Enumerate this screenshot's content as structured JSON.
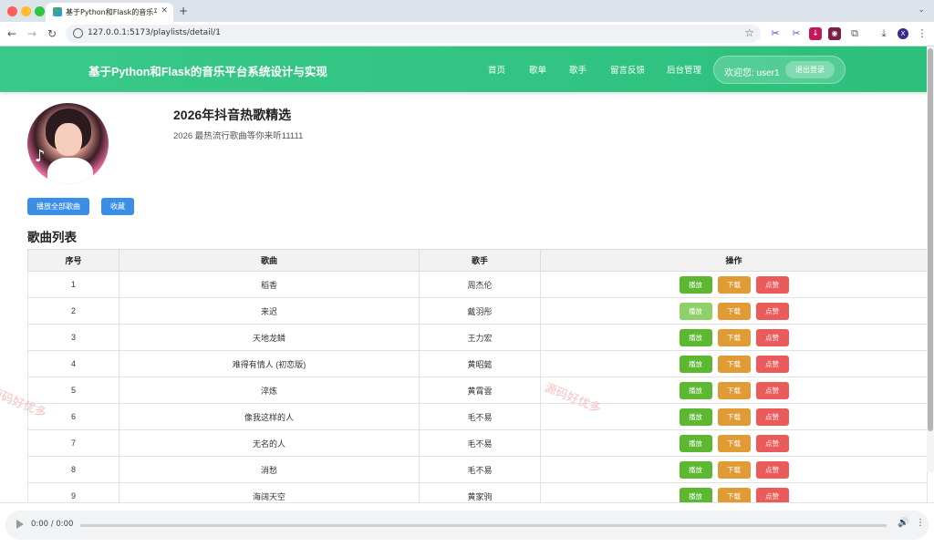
{
  "browser": {
    "tab_title": "基于Python和Flask的音乐平台",
    "url": "127.0.0.1:5173/playlists/detail/1",
    "profile_initial": "X"
  },
  "header": {
    "site_title": "基于Python和Flask的音乐平台系统设计与实现",
    "nav": [
      {
        "label": "首页"
      },
      {
        "label": "歌单"
      },
      {
        "label": "歌手"
      },
      {
        "label": "留言反馈"
      },
      {
        "label": "后台管理"
      }
    ],
    "welcome": "欢迎您: user1",
    "logout_label": "退出登录"
  },
  "playlist": {
    "title": "2026年抖音热歌精选",
    "description": "2026 最热流行歌曲等你来听11111",
    "play_all_label": "播放全部歌曲",
    "favorite_label": "收藏"
  },
  "songs_section": {
    "title": "歌曲列表",
    "columns": [
      "序号",
      "歌曲",
      "歌手",
      "操作"
    ],
    "action_labels": {
      "play": "播放",
      "download": "下载",
      "like": "点赞"
    },
    "rows": [
      {
        "no": "1",
        "song": "稻香",
        "artist": "周杰伦"
      },
      {
        "no": "2",
        "song": "来迟",
        "artist": "戴羽彤"
      },
      {
        "no": "3",
        "song": "天地龙鳞",
        "artist": "王力宏"
      },
      {
        "no": "4",
        "song": "难得有情人 (初恋版)",
        "artist": "黄昭懿"
      },
      {
        "no": "5",
        "song": "淬炼",
        "artist": "黄霄雲"
      },
      {
        "no": "6",
        "song": "像我这样的人",
        "artist": "毛不易"
      },
      {
        "no": "7",
        "song": "无名的人",
        "artist": "毛不易"
      },
      {
        "no": "8",
        "song": "消愁",
        "artist": "毛不易"
      },
      {
        "no": "9",
        "song": "海阔天空",
        "artist": "黄家驹"
      }
    ]
  },
  "player": {
    "time": "0:00 / 0:00"
  },
  "watermark": "源码好优多",
  "colors": {
    "header_green": "#2cc07c",
    "primary_blue": "#3a8ee6",
    "play_green": "#5bb830",
    "download_orange": "#e09b35",
    "like_red": "#ec5b5b"
  }
}
